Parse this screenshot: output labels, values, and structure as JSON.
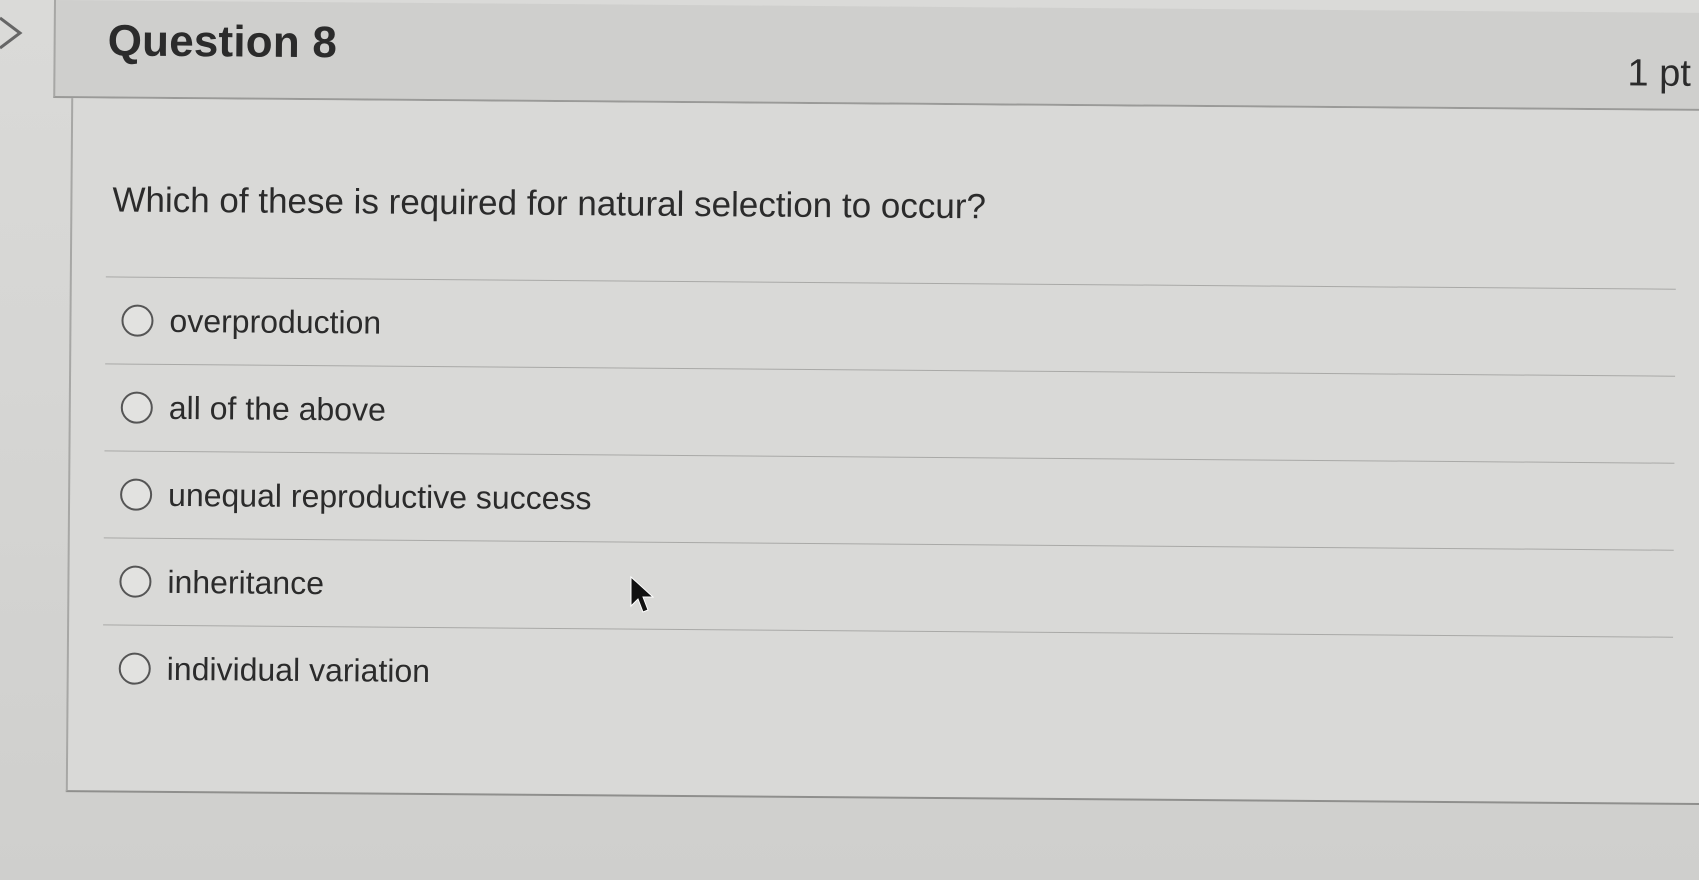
{
  "question": {
    "title": "Question 8",
    "points": "1 pt",
    "text": "Which of these is required for natural selection to occur?",
    "answers": [
      "overproduction",
      "all of the above",
      "unequal reproductive success",
      "inheritance",
      "individual variation"
    ]
  },
  "icons": {
    "collapse": "chevron-right-icon",
    "radio": "radio-button-icon",
    "pointer": "mouse-cursor-icon"
  }
}
